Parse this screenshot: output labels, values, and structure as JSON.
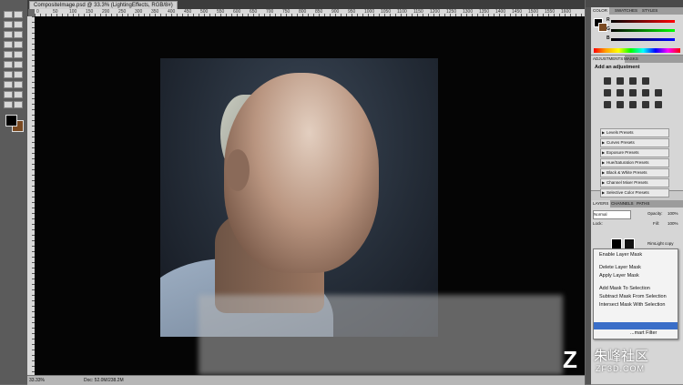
{
  "document": {
    "tab_title": "CompositeImage.psd @ 33.3% (LightingEffects, RGB/8#)",
    "zoom": "33.33%",
    "doc_info": "Doc: 52.0M/238.2M"
  },
  "ruler_labels": [
    "0",
    "50",
    "100",
    "150",
    "200",
    "250",
    "300",
    "350",
    "400",
    "450",
    "500",
    "550",
    "600",
    "650",
    "700",
    "750",
    "800",
    "850",
    "900",
    "950",
    "1000",
    "1050",
    "1100",
    "1150",
    "1200",
    "1250",
    "1300",
    "1350",
    "1400",
    "1450",
    "1500",
    "1550",
    "1600"
  ],
  "color_panel": {
    "tabs": [
      "COLOR",
      "SWATCHES",
      "STYLES"
    ],
    "channels": [
      "R",
      "G",
      "B"
    ]
  },
  "adjustments_panel": {
    "tabs": [
      "ADJUSTMENTS",
      "MASKS"
    ],
    "title": "Add an adjustment",
    "presets": [
      "Levels Presets",
      "Curves Presets",
      "Exposure Presets",
      "Hue/Saturation Presets",
      "Black & White Presets",
      "Channel Mixer Presets",
      "Selective Color Presets"
    ]
  },
  "layers_panel": {
    "tabs": [
      "LAYERS",
      "CHANNELS",
      "PATHS"
    ],
    "blend_mode": "Normal",
    "opacity_label": "Opacity:",
    "opacity_value": "100%",
    "lock_label": "Lock:",
    "fill_label": "Fill:",
    "fill_value": "100%",
    "layer_name": "RimLight copy"
  },
  "context_menu": {
    "items": [
      "Enable Layer Mask",
      "Delete Layer Mask",
      "Apply Layer Mask",
      "Add Mask To Selection",
      "Subtract Mask From Selection",
      "Intersect Mask With Selection"
    ],
    "partial_item": "...mart Filter"
  },
  "watermark": {
    "cn": "朱峰社区",
    "en": "ZF3D.COM"
  },
  "colors": {
    "canvas_bg": "#050505",
    "menu_highlight": "#3a6ec8",
    "panel_bg": "#d6d6d6"
  }
}
